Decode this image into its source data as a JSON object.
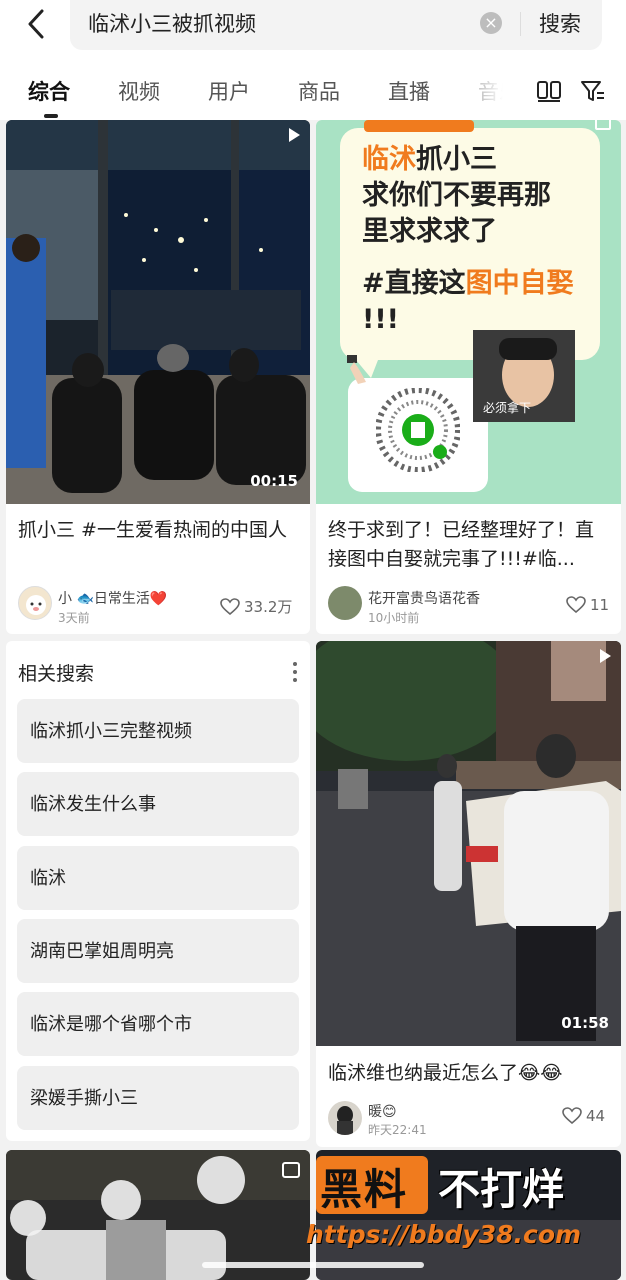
{
  "search": {
    "query": "临沭小三被抓视频",
    "button": "搜索"
  },
  "tabs": [
    "综合",
    "视频",
    "用户",
    "商品",
    "直播",
    "音乐"
  ],
  "icons": {
    "back": "chevron-left-icon",
    "clear": "clear-icon",
    "layout": "two-column-icon",
    "filter": "filter-icon",
    "heart": "heart-icon",
    "more": "more-vertical-icon",
    "play": "play-icon"
  },
  "cards": {
    "c1": {
      "duration": "00:15",
      "title": "抓小三 #一生爱看热闹的中国人",
      "author": "小 🐟日常生活❤️",
      "time": "3天前",
      "likes": "33.2万"
    },
    "c2": {
      "overlay_line1_accent": "临沭",
      "overlay_line1": "抓小三",
      "overlay_line2": "求你们不要再那",
      "overlay_line3": "里求求求了",
      "overlay_line4_a": "#直接这",
      "overlay_line4_b": "图中自娶",
      "overlay_line5": "!!!",
      "face_caption": "必须拿下",
      "title": "终于求到了！已经整理好了！直接图中自娶就完事了!!!#临...",
      "author": "花开富贵鸟语花香",
      "time": "10小时前",
      "likes": "11"
    },
    "c3": {
      "duration": "01:58",
      "title": "临沭维也纳最近怎么了😂😂",
      "author": "暖😊",
      "time": "昨天22:41",
      "likes": "44"
    }
  },
  "related": {
    "title": "相关搜索",
    "items": [
      "临沭抓小三完整视频",
      "临沭发生什么事",
      "临沭",
      "湖南巴掌姐周明亮",
      "临沭是哪个省哪个市",
      "梁媛手撕小三"
    ]
  },
  "watermark": {
    "brand_a": "黑料",
    "brand_b": "不打烊",
    "url": "https://bbdy38.com"
  },
  "colors": {
    "accent_orange": "#f07b1e",
    "green_bg": "#a9e2c4",
    "wechat_green": "#1aad19"
  }
}
